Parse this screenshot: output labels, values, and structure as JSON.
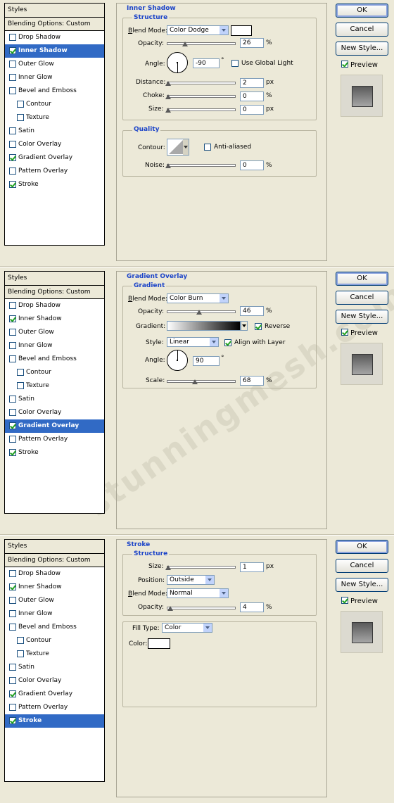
{
  "styles_title": "Styles",
  "blending_options": "Blending Options: Custom",
  "style_items": [
    {
      "label": "Drop Shadow",
      "sub": false
    },
    {
      "label": "Inner Shadow",
      "sub": false
    },
    {
      "label": "Outer Glow",
      "sub": false
    },
    {
      "label": "Inner Glow",
      "sub": false
    },
    {
      "label": "Bevel and Emboss",
      "sub": false
    },
    {
      "label": "Contour",
      "sub": true
    },
    {
      "label": "Texture",
      "sub": true
    },
    {
      "label": "Satin",
      "sub": false
    },
    {
      "label": "Color Overlay",
      "sub": false
    },
    {
      "label": "Gradient Overlay",
      "sub": false
    },
    {
      "label": "Pattern Overlay",
      "sub": false
    },
    {
      "label": "Stroke",
      "sub": false
    }
  ],
  "buttons": {
    "ok": "OK",
    "cancel": "Cancel",
    "new_style": "New Style...",
    "preview": "Preview"
  },
  "colors": {
    "selection": "#316ac5",
    "section_title": "#1c44c8",
    "background": "#ece9d8"
  },
  "watermark": "stunningmesh.com",
  "panels": [
    {
      "id": "inner-shadow",
      "active": "Inner Shadow",
      "checked": [
        "Inner Shadow",
        "Gradient Overlay",
        "Stroke"
      ],
      "title": "Inner Shadow",
      "structure_title": "Structure",
      "blend_mode_label": "Blend Mode:",
      "blend_mode": "Color Dodge",
      "opacity_label": "Opacity:",
      "opacity": "26",
      "angle_label": "Angle:",
      "angle": "-90",
      "use_global_light": "Use Global Light",
      "use_global_light_checked": false,
      "distance_label": "Distance:",
      "distance": "2",
      "choke_label": "Choke:",
      "choke": "0",
      "size_label": "Size:",
      "size": "0",
      "quality_title": "Quality",
      "contour_label": "Contour:",
      "anti_aliased": "Anti-aliased",
      "anti_aliased_checked": false,
      "noise_label": "Noise:",
      "noise": "0",
      "unit_px": "px",
      "unit_pct": "%",
      "unit_deg": "°"
    },
    {
      "id": "gradient-overlay",
      "active": "Gradient Overlay",
      "checked": [
        "Inner Shadow",
        "Gradient Overlay",
        "Stroke"
      ],
      "title": "Gradient Overlay",
      "group_title": "Gradient",
      "blend_mode_label": "Blend Mode:",
      "blend_mode": "Color Burn",
      "opacity_label": "Opacity:",
      "opacity": "46",
      "gradient_label": "Gradient:",
      "reverse": "Reverse",
      "reverse_checked": true,
      "style_label": "Style:",
      "style": "Linear",
      "align_with_layer": "Align with Layer",
      "align_checked": true,
      "angle_label": "Angle:",
      "angle": "90",
      "scale_label": "Scale:",
      "scale": "68",
      "unit_pct": "%",
      "unit_deg": "°"
    },
    {
      "id": "stroke",
      "active": "Stroke",
      "checked": [
        "Inner Shadow",
        "Gradient Overlay",
        "Stroke"
      ],
      "title": "Stroke",
      "structure_title": "Structure",
      "size_label": "Size:",
      "size": "1",
      "position_label": "Position:",
      "position": "Outside",
      "blend_mode_label": "Blend Mode:",
      "blend_mode": "Normal",
      "opacity_label": "Opacity:",
      "opacity": "4",
      "fill_type_label": "Fill Type:",
      "fill_type": "Color",
      "color_label": "Color:",
      "unit_px": "px",
      "unit_pct": "%"
    }
  ]
}
